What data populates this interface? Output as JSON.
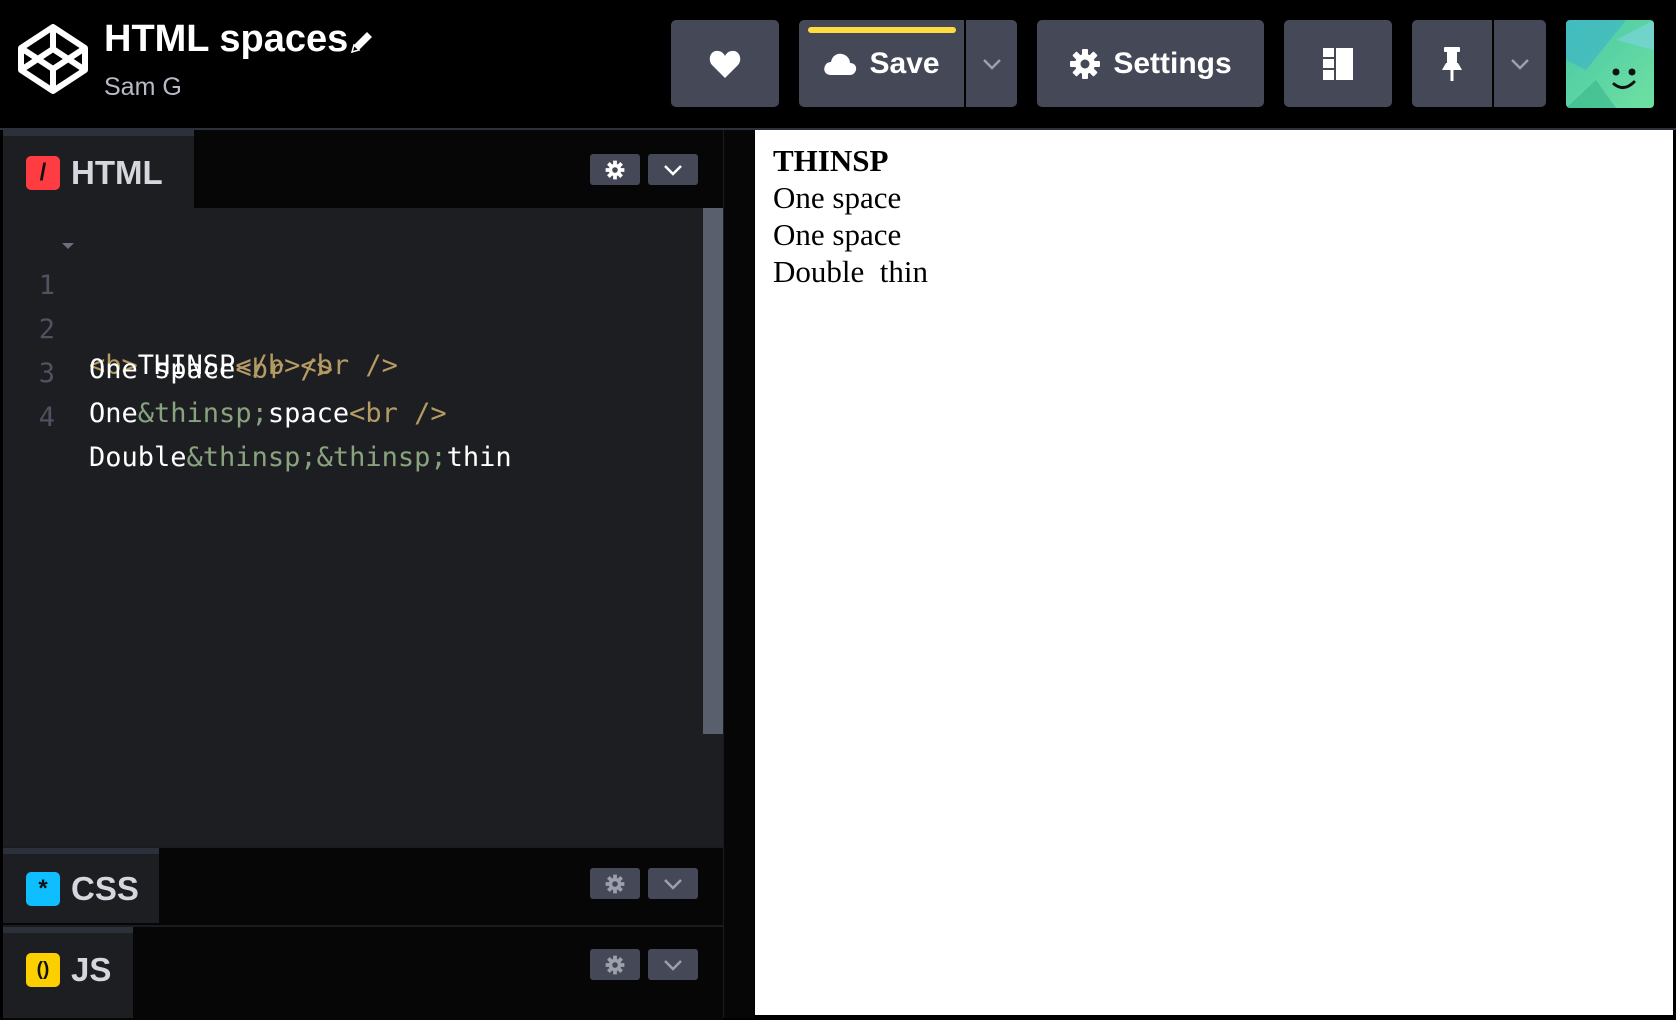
{
  "header": {
    "title": "HTML spaces",
    "author": "Sam G",
    "save_label": "Save",
    "settings_label": "Settings",
    "accent_color": "#ffdd40"
  },
  "icons": {
    "logo": "codepen-cube-icon",
    "edit": "pencil-icon",
    "love": "heart-icon",
    "save": "cloud-icon",
    "settings": "gear-icon",
    "layout": "layout-columns-icon",
    "pin": "pin-icon",
    "dropdown": "chevron-down-icon"
  },
  "editors": {
    "html": {
      "label": "HTML",
      "icon_glyph": "/",
      "icon_color": "#ff3c41",
      "lines": [
        {
          "num": "1",
          "tokens": [
            {
              "t": "tag",
              "v": "<b>"
            },
            {
              "t": "text",
              "v": "THINSP"
            },
            {
              "t": "tag",
              "v": "</b><br />"
            }
          ]
        },
        {
          "num": "2",
          "tokens": [
            {
              "t": "text",
              "v": "One space"
            },
            {
              "t": "tag",
              "v": "<br />"
            }
          ]
        },
        {
          "num": "3",
          "tokens": [
            {
              "t": "text",
              "v": "One"
            },
            {
              "t": "ent",
              "v": "&thinsp;"
            },
            {
              "t": "text",
              "v": "space"
            },
            {
              "t": "tag",
              "v": "<br />"
            }
          ]
        },
        {
          "num": "4",
          "tokens": [
            {
              "t": "text",
              "v": "Double"
            },
            {
              "t": "ent",
              "v": "&thinsp;&thinsp;"
            },
            {
              "t": "text",
              "v": "thin"
            }
          ]
        }
      ]
    },
    "css": {
      "label": "CSS",
      "icon_glyph": "*",
      "icon_color": "#0ebeff"
    },
    "js": {
      "label": "JS",
      "icon_glyph": "()",
      "icon_color": "#fcd000"
    }
  },
  "output": {
    "heading": "THINSP",
    "lines": [
      "One space",
      "One space",
      "Double  thin"
    ]
  }
}
